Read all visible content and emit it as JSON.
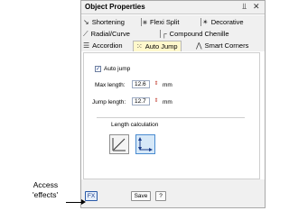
{
  "window": {
    "title": "Object Properties",
    "pin_icon": "pin-icon",
    "close_icon": "close-icon"
  },
  "tabs": {
    "row1": [
      {
        "label": "Shortening",
        "icon": "shortening-icon"
      },
      {
        "label": "Flexi Split",
        "icon": "flexi-split-icon"
      },
      {
        "label": "Decorative",
        "icon": "decorative-icon"
      }
    ],
    "row2": [
      {
        "label": "Radial/Curve",
        "icon": "radial-curve-icon"
      },
      {
        "label": "Compound Chenille",
        "icon": "compound-chenille-icon"
      }
    ],
    "row3": [
      {
        "label": "Accordion",
        "icon": "accordion-icon"
      },
      {
        "label": "Auto Jump",
        "icon": "auto-jump-icon",
        "active": true
      },
      {
        "label": "Smart Corners",
        "icon": "smart-corners-icon"
      }
    ]
  },
  "auto_jump": {
    "checkbox_label": "Auto jump",
    "checked": true,
    "max_length": {
      "label": "Max length:",
      "value": "12.6",
      "unit": "mm"
    },
    "jump_length": {
      "label": "Jump length:",
      "value": "12.7",
      "unit": "mm"
    },
    "length_calc_label": "Length calculation"
  },
  "bottom": {
    "fx_label": "FX",
    "save_label": "Save",
    "help_label": "?"
  },
  "callout": {
    "line1": "Access",
    "line2": "'effects'"
  },
  "colors": {
    "active_tab": "#fff8cc",
    "selected_button": "#d6e8f8",
    "accent_red": "#c0392b"
  }
}
